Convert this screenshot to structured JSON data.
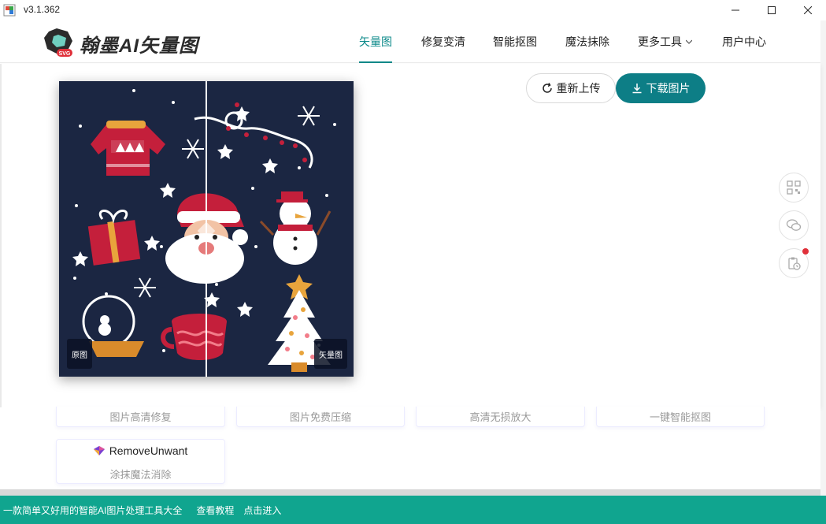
{
  "window": {
    "version": "v3.1.362",
    "controls": [
      "minimize",
      "maximize",
      "close"
    ]
  },
  "header": {
    "brand": "翰墨AI矢量图",
    "logo_badge": "SVG",
    "nav": [
      {
        "label": "矢量图",
        "active": true
      },
      {
        "label": "修复变清",
        "active": false
      },
      {
        "label": "智能抠图",
        "active": false
      },
      {
        "label": "魔法抹除",
        "active": false
      },
      {
        "label": "更多工具",
        "active": false,
        "has_dropdown": true
      },
      {
        "label": "用户中心",
        "active": false
      }
    ]
  },
  "editor": {
    "tag_original": "原图",
    "tag_vector": "矢量图",
    "reupload_label": "重新上传",
    "download_label": "下载图片"
  },
  "side_tools": [
    "qrcode-icon",
    "wechat-icon",
    "clipboard-history-icon"
  ],
  "tools": {
    "cards": [
      "图片高清修复",
      "图片免费压缩",
      "高清无损放大",
      "一键智能抠图"
    ],
    "remove_unwant": {
      "title": "RemoveUnwant",
      "subtitle": "涂抹魔法消除"
    }
  },
  "footer": {
    "slogan": "一款简单又好用的智能AI图片处理工具大全",
    "tutorial": "查看教程",
    "enter": "点击进入"
  },
  "colors": {
    "accent": "#0d8a8a",
    "download": "#0d7e86",
    "footer": "#10a58f",
    "canvas_bg": "#1b2642"
  }
}
